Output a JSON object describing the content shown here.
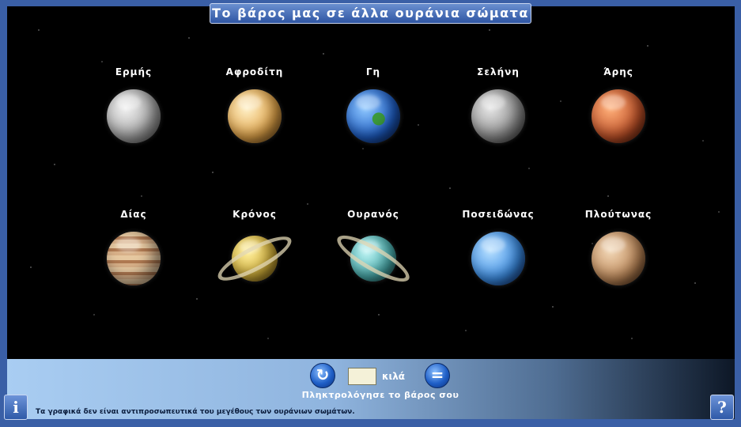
{
  "title": "Το βάρος μας σε άλλα ουράνια σώματα",
  "planets": [
    {
      "name": "Ερμής",
      "color": "#cfcfcf"
    },
    {
      "name": "Αφροδίτη",
      "color": "#e7b15a"
    },
    {
      "name": "Γη",
      "color": "#2f6fd6"
    },
    {
      "name": "Σελήνη",
      "color": "#9a9a9a"
    },
    {
      "name": "Άρης",
      "color": "#c4542a"
    },
    {
      "name": "Δίας",
      "color": "#c59a6c"
    },
    {
      "name": "Κρόνος",
      "color": "#e0c24a"
    },
    {
      "name": "Ουρανός",
      "color": "#4fb8b8"
    },
    {
      "name": "Ποσειδώνας",
      "color": "#3c8ee6"
    },
    {
      "name": "Πλούτωνας",
      "color": "#c08a5a"
    }
  ],
  "controls": {
    "refresh_icon": "refresh-icon",
    "equals_icon": "equals-icon",
    "weight_value": "",
    "unit": "κιλά",
    "prompt": "Πληκτρολόγησε το βάρος σου"
  },
  "footnote": "Τα γραφικά δεν είναι αντιπροσωπευτικά του μεγέθους των ουράνιων σωμάτων.",
  "info_button": "i",
  "help_button": "?"
}
